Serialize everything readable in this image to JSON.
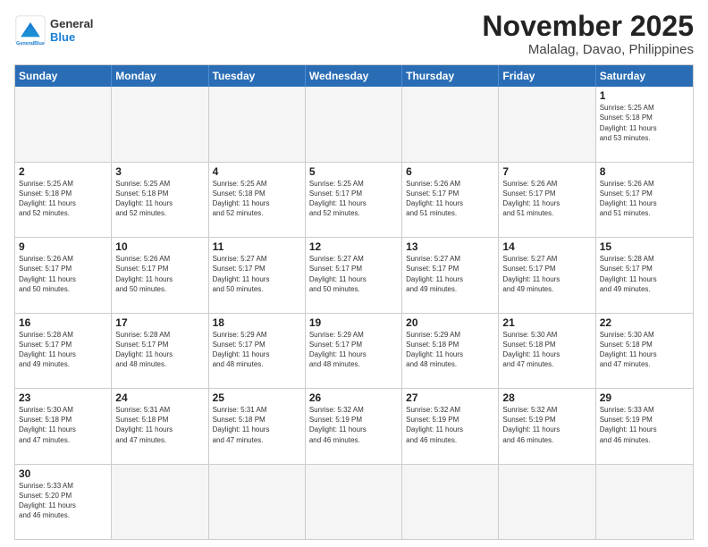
{
  "logo": {
    "general": "General",
    "blue": "Blue"
  },
  "title": "November 2025",
  "subtitle": "Malalag, Davao, Philippines",
  "headers": [
    "Sunday",
    "Monday",
    "Tuesday",
    "Wednesday",
    "Thursday",
    "Friday",
    "Saturday"
  ],
  "rows": [
    [
      {
        "day": "",
        "info": ""
      },
      {
        "day": "",
        "info": ""
      },
      {
        "day": "",
        "info": ""
      },
      {
        "day": "",
        "info": ""
      },
      {
        "day": "",
        "info": ""
      },
      {
        "day": "",
        "info": ""
      },
      {
        "day": "1",
        "info": "Sunrise: 5:25 AM\nSunset: 5:18 PM\nDaylight: 11 hours\nand 53 minutes."
      }
    ],
    [
      {
        "day": "2",
        "info": "Sunrise: 5:25 AM\nSunset: 5:18 PM\nDaylight: 11 hours\nand 52 minutes."
      },
      {
        "day": "3",
        "info": "Sunrise: 5:25 AM\nSunset: 5:18 PM\nDaylight: 11 hours\nand 52 minutes."
      },
      {
        "day": "4",
        "info": "Sunrise: 5:25 AM\nSunset: 5:18 PM\nDaylight: 11 hours\nand 52 minutes."
      },
      {
        "day": "5",
        "info": "Sunrise: 5:25 AM\nSunset: 5:17 PM\nDaylight: 11 hours\nand 52 minutes."
      },
      {
        "day": "6",
        "info": "Sunrise: 5:26 AM\nSunset: 5:17 PM\nDaylight: 11 hours\nand 51 minutes."
      },
      {
        "day": "7",
        "info": "Sunrise: 5:26 AM\nSunset: 5:17 PM\nDaylight: 11 hours\nand 51 minutes."
      },
      {
        "day": "8",
        "info": "Sunrise: 5:26 AM\nSunset: 5:17 PM\nDaylight: 11 hours\nand 51 minutes."
      }
    ],
    [
      {
        "day": "9",
        "info": "Sunrise: 5:26 AM\nSunset: 5:17 PM\nDaylight: 11 hours\nand 50 minutes."
      },
      {
        "day": "10",
        "info": "Sunrise: 5:26 AM\nSunset: 5:17 PM\nDaylight: 11 hours\nand 50 minutes."
      },
      {
        "day": "11",
        "info": "Sunrise: 5:27 AM\nSunset: 5:17 PM\nDaylight: 11 hours\nand 50 minutes."
      },
      {
        "day": "12",
        "info": "Sunrise: 5:27 AM\nSunset: 5:17 PM\nDaylight: 11 hours\nand 50 minutes."
      },
      {
        "day": "13",
        "info": "Sunrise: 5:27 AM\nSunset: 5:17 PM\nDaylight: 11 hours\nand 49 minutes."
      },
      {
        "day": "14",
        "info": "Sunrise: 5:27 AM\nSunset: 5:17 PM\nDaylight: 11 hours\nand 49 minutes."
      },
      {
        "day": "15",
        "info": "Sunrise: 5:28 AM\nSunset: 5:17 PM\nDaylight: 11 hours\nand 49 minutes."
      }
    ],
    [
      {
        "day": "16",
        "info": "Sunrise: 5:28 AM\nSunset: 5:17 PM\nDaylight: 11 hours\nand 49 minutes."
      },
      {
        "day": "17",
        "info": "Sunrise: 5:28 AM\nSunset: 5:17 PM\nDaylight: 11 hours\nand 48 minutes."
      },
      {
        "day": "18",
        "info": "Sunrise: 5:29 AM\nSunset: 5:17 PM\nDaylight: 11 hours\nand 48 minutes."
      },
      {
        "day": "19",
        "info": "Sunrise: 5:29 AM\nSunset: 5:17 PM\nDaylight: 11 hours\nand 48 minutes."
      },
      {
        "day": "20",
        "info": "Sunrise: 5:29 AM\nSunset: 5:18 PM\nDaylight: 11 hours\nand 48 minutes."
      },
      {
        "day": "21",
        "info": "Sunrise: 5:30 AM\nSunset: 5:18 PM\nDaylight: 11 hours\nand 47 minutes."
      },
      {
        "day": "22",
        "info": "Sunrise: 5:30 AM\nSunset: 5:18 PM\nDaylight: 11 hours\nand 47 minutes."
      }
    ],
    [
      {
        "day": "23",
        "info": "Sunrise: 5:30 AM\nSunset: 5:18 PM\nDaylight: 11 hours\nand 47 minutes."
      },
      {
        "day": "24",
        "info": "Sunrise: 5:31 AM\nSunset: 5:18 PM\nDaylight: 11 hours\nand 47 minutes."
      },
      {
        "day": "25",
        "info": "Sunrise: 5:31 AM\nSunset: 5:18 PM\nDaylight: 11 hours\nand 47 minutes."
      },
      {
        "day": "26",
        "info": "Sunrise: 5:32 AM\nSunset: 5:19 PM\nDaylight: 11 hours\nand 46 minutes."
      },
      {
        "day": "27",
        "info": "Sunrise: 5:32 AM\nSunset: 5:19 PM\nDaylight: 11 hours\nand 46 minutes."
      },
      {
        "day": "28",
        "info": "Sunrise: 5:32 AM\nSunset: 5:19 PM\nDaylight: 11 hours\nand 46 minutes."
      },
      {
        "day": "29",
        "info": "Sunrise: 5:33 AM\nSunset: 5:19 PM\nDaylight: 11 hours\nand 46 minutes."
      }
    ],
    [
      {
        "day": "30",
        "info": "Sunrise: 5:33 AM\nSunset: 5:20 PM\nDaylight: 11 hours\nand 46 minutes."
      },
      {
        "day": "",
        "info": ""
      },
      {
        "day": "",
        "info": ""
      },
      {
        "day": "",
        "info": ""
      },
      {
        "day": "",
        "info": ""
      },
      {
        "day": "",
        "info": ""
      },
      {
        "day": "",
        "info": ""
      }
    ]
  ]
}
